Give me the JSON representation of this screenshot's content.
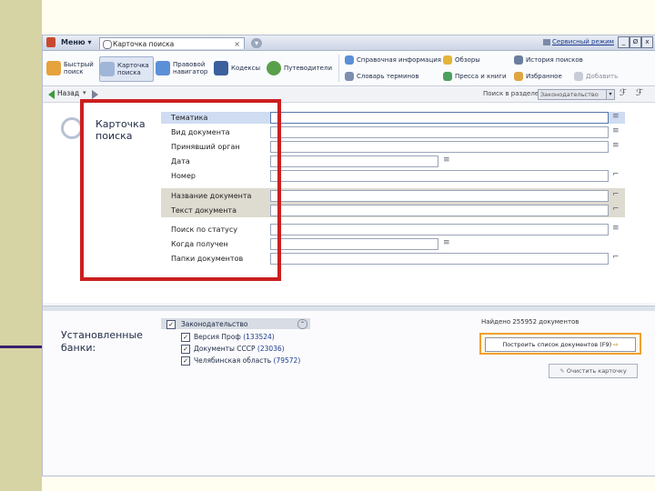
{
  "window": {
    "menu_label": "Меню ▾",
    "tab_title": "Карточка поиска",
    "tab_close": "×",
    "new_tab": "▾",
    "top_link": "Сервисный режим",
    "win_buttons": [
      "_",
      "Ø",
      "x"
    ]
  },
  "toolbar": {
    "items": [
      {
        "label": "Быстрый поиск",
        "icon": "quick-search-icon",
        "selected": false
      },
      {
        "label": "Карточка поиска",
        "icon": "search-card-icon",
        "selected": true
      },
      {
        "label": "Правовой навигатор",
        "icon": "legal-navigator-icon",
        "selected": false
      },
      {
        "label": "Кодексы",
        "icon": "codex-icon",
        "selected": false
      },
      {
        "label": "Путеводители",
        "icon": "guides-icon",
        "selected": false
      }
    ],
    "right_items": [
      {
        "label": "Справочная информация",
        "icon": "reference-icon"
      },
      {
        "label": "Словарь терминов",
        "icon": "dictionary-icon"
      },
      {
        "label": "Обзоры",
        "icon": "reviews-icon"
      },
      {
        "label": "Пресса и книги",
        "icon": "press-icon"
      },
      {
        "label": "История поисков",
        "icon": "history-icon"
      },
      {
        "label": "Избранное",
        "icon": "favorites-icon"
      },
      {
        "label": "Добавить",
        "icon": "add-icon"
      }
    ]
  },
  "navbar": {
    "back_label": "Назад",
    "search_section_label": "Поиск в разделе",
    "search_section_value": "Законодательство"
  },
  "search_card": {
    "title_line1": "Карточка",
    "title_line2": "поиска",
    "fields": [
      {
        "label": "Тематика",
        "value": ""
      },
      {
        "label": "Вид документа",
        "value": ""
      },
      {
        "label": "Принявший орган",
        "value": ""
      },
      {
        "label": "Дата",
        "value": ""
      },
      {
        "label": "Номер",
        "value": ""
      },
      {
        "label": "Название документа",
        "value": ""
      },
      {
        "label": "Текст документа",
        "value": ""
      },
      {
        "label": "Поиск по статусу",
        "value": ""
      },
      {
        "label": "Когда получен",
        "value": ""
      },
      {
        "label": "Папки документов",
        "value": ""
      }
    ]
  },
  "banks": {
    "title_line1": "Установленные",
    "title_line2": "банки:",
    "group_label": "Законодательство",
    "items": [
      {
        "name": "Версия Проф",
        "count": "(133524)"
      },
      {
        "name": "Документы СССР",
        "count": "(23036)"
      },
      {
        "name": "Челябинская область",
        "count": "(79572)"
      }
    ],
    "found_label": "Найдено 255952 документов",
    "build_button": "Построить список документов (F9)",
    "clear_button": "Очистить карточку"
  },
  "colors": {
    "highlight_box": "#cc1f1f",
    "build_outline": "#f0a030",
    "slide_band": "#d6d3a4",
    "slide_rule": "#3a1f6e"
  }
}
